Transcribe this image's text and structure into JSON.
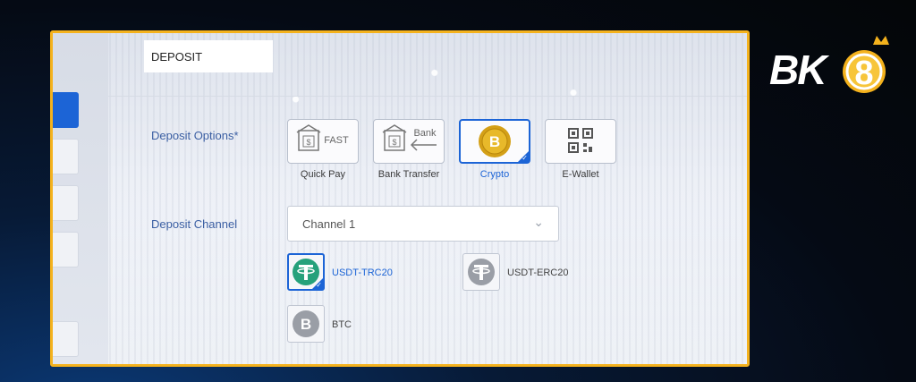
{
  "brand": {
    "logo_text": "BK8"
  },
  "colors": {
    "accent": "#1c64d6",
    "frame": "#f4b21d",
    "label": "#3b5fa3",
    "tether_green": "#26a17b",
    "gold": "#d4a017"
  },
  "deposit_tab": {
    "label": "DEPOSIT"
  },
  "deposit_options": {
    "label": "Deposit Options*",
    "items": [
      {
        "label": "Quick Pay",
        "icon": "fast-pay-icon",
        "selected": false
      },
      {
        "label": "Bank Transfer",
        "icon": "bank-transfer-icon",
        "selected": false
      },
      {
        "label": "Crypto",
        "icon": "bitcoin-coin-icon",
        "selected": true
      },
      {
        "label": "E-Wallet",
        "icon": "qr-code-icon",
        "selected": false
      }
    ],
    "fast_text": "FAST",
    "bank_text": "Bank"
  },
  "deposit_channel": {
    "label": "Deposit Channel",
    "selected": "Channel 1",
    "coins": [
      {
        "label": "USDT-TRC20",
        "icon": "tether-icon",
        "selected": true
      },
      {
        "label": "USDT-ERC20",
        "icon": "tether-icon",
        "selected": false
      },
      {
        "label": "BTC",
        "icon": "bitcoin-icon",
        "selected": false
      }
    ]
  }
}
